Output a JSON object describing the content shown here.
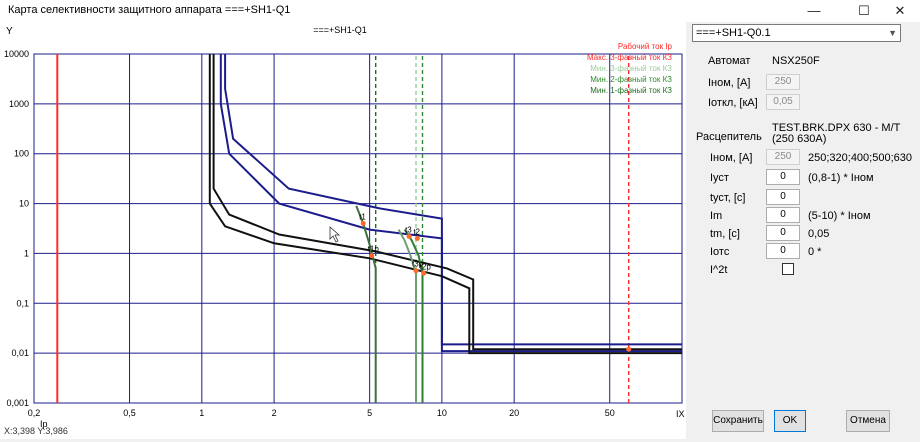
{
  "window": {
    "title": "Карта селективности защитного аппарата ===+SH1-Q1",
    "minimize": "—",
    "maximize": "☐",
    "close": "✕"
  },
  "plot": {
    "chart_title": "===+SH1-Q1",
    "y_axis_label": "Y",
    "x_axis_label": "Ip",
    "x_units": "IX",
    "y_ticks": [
      "10000",
      "1000",
      "100",
      "10",
      "1",
      "0,1",
      "0,01",
      "0,001"
    ],
    "x_ticks": [
      "0,2",
      "0,5",
      "1",
      "2",
      "5",
      "10",
      "20",
      "50"
    ],
    "legend": [
      {
        "label": "Рабочий ток Ip",
        "color": "#ff2a2a"
      },
      {
        "label": "Макс. 3-фазный ток КЗ",
        "color": "#ff2a2a"
      },
      {
        "label": "Мин. 3-фазный ток КЗ",
        "color": "#9acb9a"
      },
      {
        "label": "Мин. 2-фазный ток КЗ",
        "color": "#2e8b2e"
      },
      {
        "label": "Мин. 1-фазный ток КЗ",
        "color": "#1f6e1f"
      }
    ],
    "point_labels": [
      "t1",
      "t3",
      "t2",
      "t1p",
      "t3p",
      "t2p"
    ],
    "coords": "X:3,398   Y:3,986"
  },
  "chart_data": {
    "type": "line",
    "title": "===+SH1-Q1",
    "xlabel": "Ip",
    "ylabel": "Y",
    "x_scale": "log",
    "y_scale": "log",
    "xlim": [
      0.2,
      100
    ],
    "ylim": [
      0.001,
      10000
    ],
    "grid": true,
    "legend_position": "top-right",
    "series": [
      {
        "name": "Рабочий ток Ip",
        "color": "#ff2a2a",
        "style": "solid",
        "x": [
          0.25,
          0.25
        ],
        "y": [
          0.001,
          10000
        ]
      },
      {
        "name": "Макс. 3-фазный ток КЗ",
        "color": "#ff2a2a",
        "style": "dashed",
        "x": [
          60,
          60
        ],
        "y": [
          0.001,
          10000
        ]
      },
      {
        "name": "Мин. 3-фазный ток КЗ",
        "color": "#9acb9a",
        "style": "dashed",
        "x": [
          7.8,
          7.8
        ],
        "y": [
          0.001,
          10000
        ]
      },
      {
        "name": "Мин. 2-фазный ток КЗ",
        "color": "#2e8b2e",
        "style": "dashed",
        "x": [
          8.3,
          8.3
        ],
        "y": [
          0.001,
          10000
        ]
      },
      {
        "name": "Мин. 1-фазный ток КЗ",
        "color": "#1f6e1f",
        "style": "dashed",
        "x": [
          5.3,
          5.3
        ],
        "y": [
          0.001,
          10000
        ]
      },
      {
        "color": "#1c1c8c",
        "style": "solid",
        "x": [
          1.2,
          1.2,
          1.3,
          2.1,
          5.0,
          10,
          10,
          100
        ],
        "y": [
          10000,
          1000,
          100,
          10,
          3.0,
          2.0,
          0.011,
          0.011
        ]
      },
      {
        "color": "#1c1c8c",
        "style": "solid",
        "x": [
          1.25,
          1.25,
          1.35,
          2.3,
          5.5,
          10,
          10,
          100
        ],
        "y": [
          10000,
          2000,
          200,
          20,
          8.0,
          5.0,
          0.015,
          0.015
        ]
      },
      {
        "color": "#111111",
        "style": "solid",
        "x": [
          1.08,
          1.08,
          1.25,
          2.0,
          5.0,
          10,
          13,
          13,
          100
        ],
        "y": [
          10000,
          10,
          3.5,
          1.6,
          0.8,
          0.35,
          0.2,
          0.01,
          0.01
        ]
      },
      {
        "color": "#111111",
        "style": "solid",
        "x": [
          1.12,
          1.12,
          1.3,
          2.1,
          5.3,
          10.5,
          13.5,
          13.5,
          100
        ],
        "y": [
          10000,
          20,
          6.0,
          2.4,
          1.1,
          0.5,
          0.3,
          0.012,
          0.012
        ]
      },
      {
        "color": "#3e6f3e",
        "style": "solid",
        "x": [
          4.4,
          4.7,
          5.0,
          5.3,
          5.3
        ],
        "y": [
          9.0,
          4.0,
          1.5,
          0.5,
          0.001
        ]
      },
      {
        "color": "#6fa06f",
        "style": "solid",
        "x": [
          6.6,
          7.0,
          7.4,
          7.8,
          7.8
        ],
        "y": [
          3.0,
          1.8,
          0.9,
          0.4,
          0.001
        ]
      },
      {
        "color": "#2e7f2e",
        "style": "solid",
        "x": [
          7.0,
          7.5,
          8.0,
          8.3,
          8.3
        ],
        "y": [
          3.0,
          1.8,
          0.9,
          0.4,
          0.001
        ]
      }
    ]
  },
  "right": {
    "device_select": "===+SH1-Q0.1",
    "breaker_label": "Автомат",
    "breaker_value": "NSX250F",
    "inom_label": "Iном, [A]",
    "inom_value": "250",
    "ioff_label": "Iоткл, [кА]",
    "ioff_value": "0,05",
    "release_label": "Расцепитель",
    "release_value": "TEST.BRK.DPX 630 - M/T (250 630A)",
    "rel_inom_label": "Iном, [A]",
    "rel_inom_value": "250",
    "rel_inom_options": "250;320;400;500;630",
    "iust_label": "Iуст",
    "iust_value": "0",
    "iust_hint": "(0,8-1) * Iном",
    "tust_label": "tуст, [c]",
    "tust_value": "0",
    "im_label": "Im",
    "im_value": "0",
    "im_hint": "(5-10) * Iном",
    "tm_label": "tm, [c]",
    "tm_value": "0",
    "tm_hint": "0,05",
    "iotc_label": "Iотс",
    "iotc_value": "0",
    "iotc_hint": "0 *",
    "i2t_label": "I^2t"
  },
  "buttons": {
    "save": "Сохранить",
    "ok": "OK",
    "cancel": "Отмена"
  }
}
